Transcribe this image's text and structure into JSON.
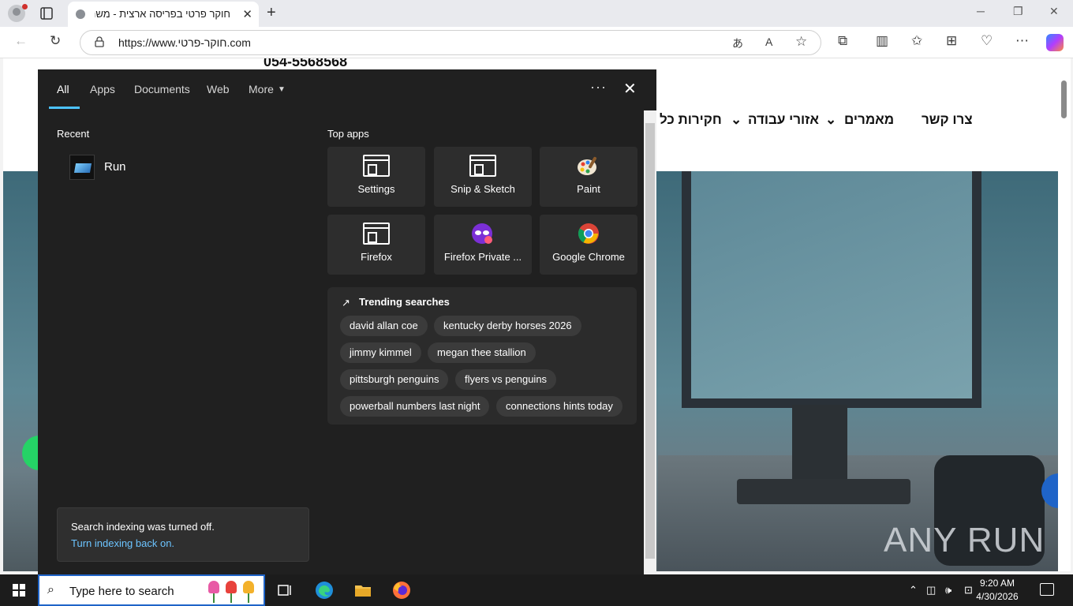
{
  "browser": {
    "tab_title": "חוקר פרטי בפריסה ארצית - משרד",
    "url": "https://www.חוקר-פרטי.com"
  },
  "website": {
    "phone": "054-5568568",
    "nav": [
      "צרו קשר",
      "מאמרים",
      "אזורי עבודה",
      "חקירות כל"
    ],
    "watermark": "ANY RUN"
  },
  "search_panel": {
    "tabs": [
      "All",
      "Apps",
      "Documents",
      "Web",
      "More"
    ],
    "active_tab": "All",
    "recent_heading": "Recent",
    "recent_items": [
      "Run"
    ],
    "top_apps_heading": "Top apps",
    "top_apps": [
      {
        "label": "Settings",
        "icon": "window-app-icon"
      },
      {
        "label": "Snip & Sketch",
        "icon": "window-app-icon"
      },
      {
        "label": "Paint",
        "icon": "paint-palette-icon"
      },
      {
        "label": "Firefox",
        "icon": "window-app-icon"
      },
      {
        "label": "Firefox Private ...",
        "icon": "firefox-private-icon"
      },
      {
        "label": "Google Chrome",
        "icon": "chrome-icon"
      }
    ],
    "trending_heading": "Trending searches",
    "trending": [
      "david allan coe",
      "kentucky derby horses 2026",
      "jimmy kimmel",
      "megan thee stallion",
      "pittsburgh penguins",
      "flyers vs penguins",
      "powerball numbers last night",
      "connections hints today"
    ],
    "notice_text": "Search indexing was turned off.",
    "notice_link": "Turn indexing back on."
  },
  "taskbar": {
    "search_placeholder": "Type here to search",
    "time": "9:20 AM",
    "date": "4/30/2026"
  },
  "colors": {
    "accent": "#4cc2ff",
    "panel_bg": "#202020",
    "link": "#6cc4ff"
  }
}
